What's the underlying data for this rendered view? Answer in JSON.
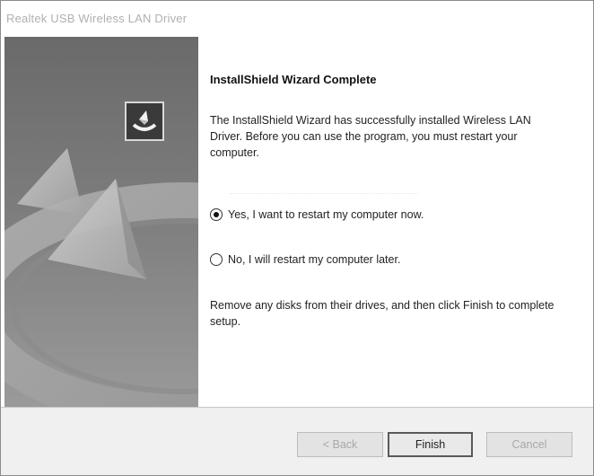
{
  "window": {
    "title": "Realtek USB Wireless LAN Driver"
  },
  "content": {
    "heading": "InstallShield Wizard Complete",
    "message": "The InstallShield Wizard has successfully installed Wireless LAN Driver.  Before you can use the program, you must restart your computer.",
    "restart_options": [
      {
        "label": "Yes, I want to restart my computer now.",
        "selected": true
      },
      {
        "label": "No, I will restart my computer later.",
        "selected": false
      }
    ],
    "instruction": "Remove any disks from their drives, and then click Finish to complete setup."
  },
  "buttons": {
    "back": "< Back",
    "finish": "Finish",
    "cancel": "Cancel"
  },
  "states": {
    "back_enabled": false,
    "finish_enabled": true,
    "cancel_enabled": false
  },
  "icons": {
    "logo": "installshield-logo-icon",
    "side_art": "installshield-wizard-art"
  }
}
